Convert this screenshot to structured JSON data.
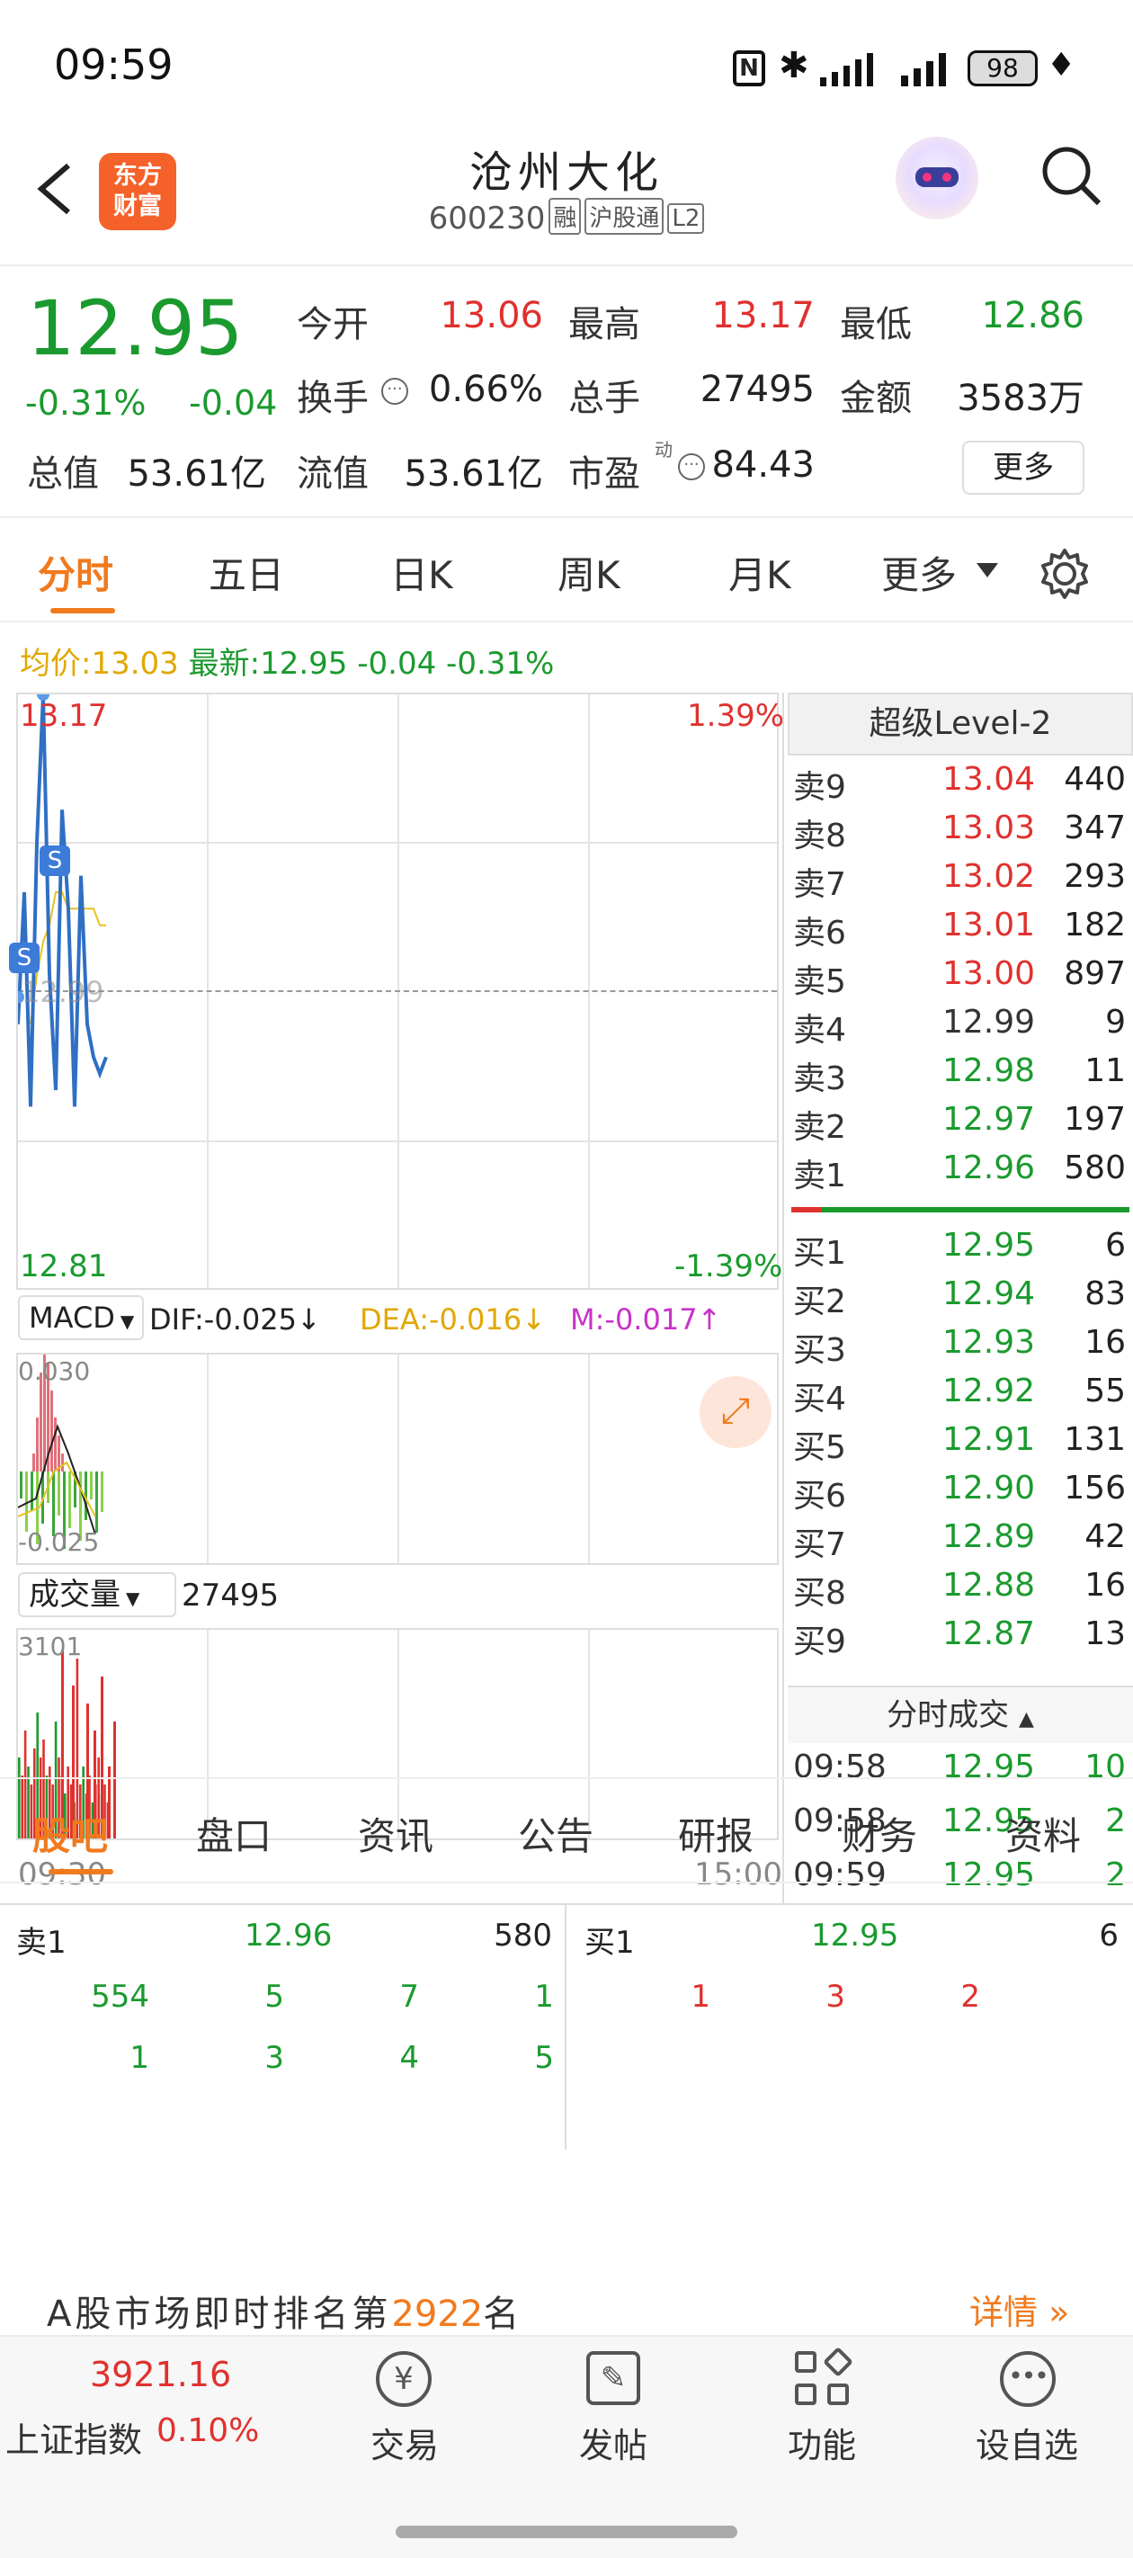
{
  "status": {
    "time": "09:59",
    "battery": "98"
  },
  "header": {
    "logo_line1": "东方",
    "logo_line2": "财富",
    "title": "沧州大化",
    "code": "600230",
    "tag1": "融",
    "tag2": "沪股通",
    "tag3": "L2"
  },
  "quote": {
    "price": "12.95",
    "change_pct": "-0.31%",
    "change": "-0.04",
    "open_label": "今开",
    "open": "13.06",
    "high_label": "最高",
    "high": "13.17",
    "low_label": "最低",
    "low": "12.86",
    "turnover_label": "换手",
    "turnover": "0.66%",
    "volume_label": "总手",
    "volume": "27495",
    "amount_label": "金额",
    "amount": "3583万",
    "mcap_label": "总值",
    "mcap": "53.61亿",
    "float_label": "流值",
    "float": "53.61亿",
    "pe_label": "市盈",
    "pe_sup": "动",
    "pe": "84.43",
    "more": "更多"
  },
  "tabs": [
    "分时",
    "五日",
    "日K",
    "周K",
    "月K",
    "更多"
  ],
  "infoline": {
    "avg_label": "均价:",
    "avg": "13.03",
    "last_label": "最新:",
    "last": "12.95",
    "chg": "-0.04",
    "pct": "-0.31%"
  },
  "chart_data": {
    "type": "line",
    "y_top": "13.17",
    "y_bottom": "12.81",
    "pct_top": "1.39%",
    "pct_bottom": "-1.39%",
    "ref": "12.99",
    "x_start": "09:30",
    "x_end": "15:00",
    "price": [
      12.97,
      13.05,
      12.92,
      13.08,
      13.17,
      13.0,
      12.93,
      13.1,
      13.04,
      12.92,
      13.06,
      12.97,
      12.95,
      12.94,
      12.95
    ],
    "avg": [
      12.97,
      13.0,
      13.02,
      13.03,
      13.05,
      13.05,
      13.04,
      13.04,
      13.04,
      13.04,
      13.04,
      13.03,
      13.03
    ],
    "markers": [
      "S",
      "S"
    ]
  },
  "macd": {
    "label": "MACD",
    "dif": "DIF:-0.025↓",
    "dea": "DEA:-0.016↓",
    "m": "M:-0.017↑",
    "top": "0.030",
    "bottom": "-0.025"
  },
  "vol": {
    "label": "成交量",
    "value": "27495",
    "top": "3101"
  },
  "level2": {
    "title": "超级Level-2",
    "asks": [
      {
        "l": "卖9",
        "p": "13.04",
        "v": "440"
      },
      {
        "l": "卖8",
        "p": "13.03",
        "v": "347"
      },
      {
        "l": "卖7",
        "p": "13.02",
        "v": "293"
      },
      {
        "l": "卖6",
        "p": "13.01",
        "v": "182"
      },
      {
        "l": "卖5",
        "p": "13.00",
        "v": "897"
      },
      {
        "l": "卖4",
        "p": "12.99",
        "v": "9"
      },
      {
        "l": "卖3",
        "p": "12.98",
        "v": "11"
      },
      {
        "l": "卖2",
        "p": "12.97",
        "v": "197"
      },
      {
        "l": "卖1",
        "p": "12.96",
        "v": "580"
      }
    ],
    "bids": [
      {
        "l": "买1",
        "p": "12.95",
        "v": "6"
      },
      {
        "l": "买2",
        "p": "12.94",
        "v": "83"
      },
      {
        "l": "买3",
        "p": "12.93",
        "v": "16"
      },
      {
        "l": "买4",
        "p": "12.92",
        "v": "55"
      },
      {
        "l": "买5",
        "p": "12.91",
        "v": "131"
      },
      {
        "l": "买6",
        "p": "12.90",
        "v": "156"
      },
      {
        "l": "买7",
        "p": "12.89",
        "v": "42"
      },
      {
        "l": "买8",
        "p": "12.88",
        "v": "16"
      },
      {
        "l": "买9",
        "p": "12.87",
        "v": "13"
      }
    ],
    "trades_title": "分时成交",
    "trades": [
      {
        "t": "09:58",
        "p": "12.95",
        "v": "10"
      },
      {
        "t": "09:58",
        "p": "12.95",
        "v": "2"
      },
      {
        "t": "09:59",
        "p": "12.95",
        "v": "2"
      }
    ]
  },
  "queue": {
    "sell_label": "卖1",
    "sell_price": "12.96",
    "sell_vol": "580",
    "buy_label": "买1",
    "buy_price": "12.95",
    "buy_vol": "6",
    "sell_orders": [
      "554",
      "5",
      "7",
      "1",
      "1",
      "3",
      "4",
      "5"
    ],
    "buy_orders": [
      "1",
      "3",
      "2"
    ]
  },
  "subtabs": [
    "股吧",
    "盘口",
    "资讯",
    "公告",
    "研报",
    "财务",
    "资料"
  ],
  "rank": {
    "prefix": "A股市场即时排名第",
    "num": "2922",
    "suffix": "名",
    "detail": "详情"
  },
  "bottom": {
    "index_value": "3921.16",
    "index_name": "上证指数",
    "index_pct": "0.10%",
    "trade": "交易",
    "post": "发帖",
    "func": "功能",
    "watch": "设自选"
  }
}
